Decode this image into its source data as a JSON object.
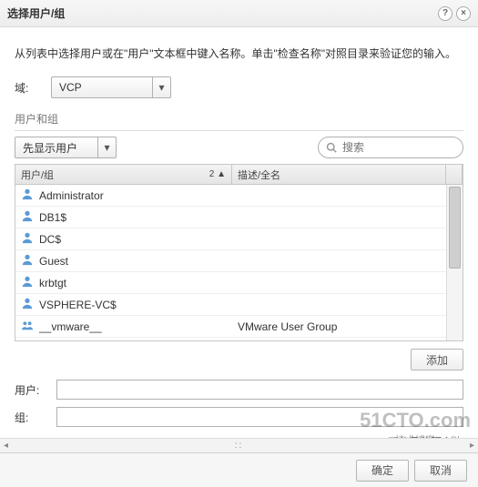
{
  "dialog": {
    "title": "选择用户/组",
    "instruction": "从列表中选择用户或在\"用户\"文本框中键入名称。单击\"检查名称\"对照目录来验证您的输入。"
  },
  "domain": {
    "label": "域:",
    "value": "VCP"
  },
  "section": {
    "title": "用户和组",
    "display_mode": "先显示用户",
    "search_placeholder": "搜索"
  },
  "grid": {
    "col_user": "用户/组",
    "col_desc": "描述/全名",
    "sort_indicator": "2 ▲",
    "rows": [
      {
        "type": "user",
        "name": "Administrator",
        "desc": ""
      },
      {
        "type": "user",
        "name": "DB1$",
        "desc": ""
      },
      {
        "type": "user",
        "name": "DC$",
        "desc": ""
      },
      {
        "type": "user",
        "name": "Guest",
        "desc": ""
      },
      {
        "type": "user",
        "name": "krbtgt",
        "desc": ""
      },
      {
        "type": "user",
        "name": "VSPHERE-VC$",
        "desc": ""
      },
      {
        "type": "group",
        "name": "__vmware__",
        "desc": "VMware User Group"
      }
    ]
  },
  "buttons": {
    "add": "添加",
    "ok": "确定",
    "cancel": "取消"
  },
  "fields": {
    "users_label": "用户:",
    "groups_label": "组:",
    "users_value": "",
    "groups_value": ""
  },
  "note": "用分号分隔多",
  "watermark": {
    "main": "51CTO.com",
    "sub": "技术博客 — Blog"
  }
}
